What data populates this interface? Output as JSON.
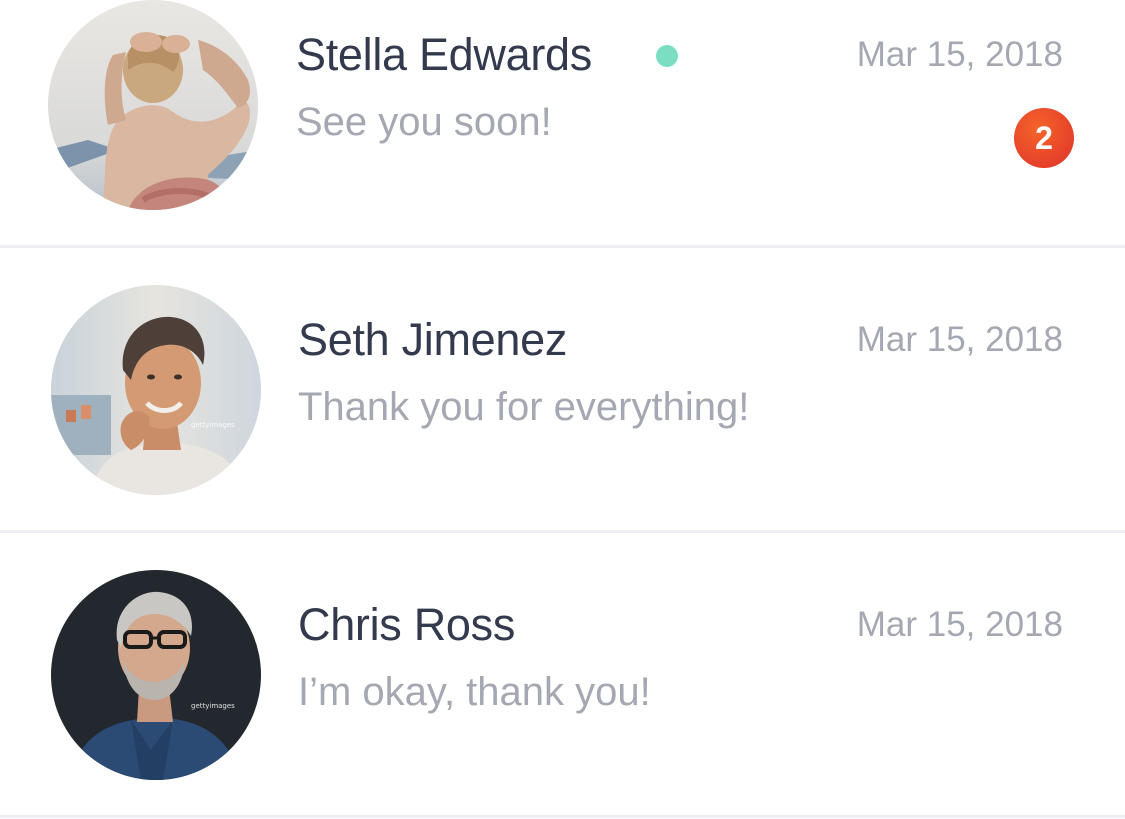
{
  "conversations": [
    {
      "name": "Stella Edwards",
      "preview": "See you soon!",
      "date": "Mar 15, 2018",
      "online": true,
      "unread_count": "2",
      "avatar_desc": "woman-portrait"
    },
    {
      "name": "Seth Jimenez",
      "preview": "Thank you for everything!",
      "date": "Mar 15, 2018",
      "online": false,
      "avatar_desc": "man-portrait",
      "watermark": "gettyimages"
    },
    {
      "name": "Chris Ross",
      "preview": "I’m okay, thank you!",
      "date": "Mar 15, 2018",
      "online": false,
      "avatar_desc": "man-portrait",
      "watermark": "gettyimages"
    }
  ],
  "colors": {
    "name_text": "#343a4d",
    "secondary_text": "#a5a8b3",
    "online_indicator": "#7bdec3",
    "badge_bg": "#e8452a",
    "divider": "#eeeff2"
  }
}
